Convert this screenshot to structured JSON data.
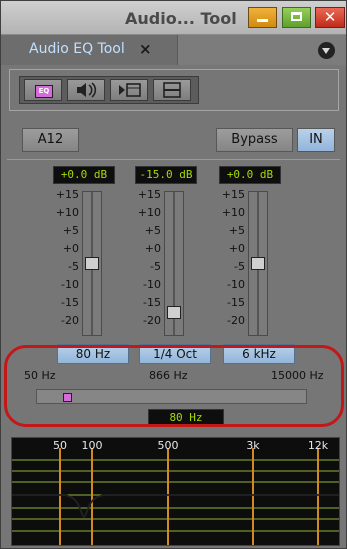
{
  "window": {
    "title": "Audio... Tool"
  },
  "tab": {
    "label": "Audio EQ Tool",
    "close": "×"
  },
  "toolbar": {
    "eq_icon_text": "EQ",
    "icons": [
      "eq-icon",
      "audio-swap-icon",
      "play-frame-icon",
      "split-icon"
    ]
  },
  "controls": {
    "track_button": "A12",
    "bypass_button": "Bypass",
    "in_button": "IN"
  },
  "bands": [
    {
      "readout": "+0.0 dB",
      "freq": "80 Hz",
      "gain_fraction": 0.5
    },
    {
      "readout": "-15.0 dB",
      "freq": "1/4 Oct",
      "gain_fraction": 0.125
    },
    {
      "readout": "+0.0 dB",
      "freq": "6 kHz",
      "gain_fraction": 0.5
    }
  ],
  "scale_labels": [
    "+15",
    "+10",
    "+5",
    "+0",
    "-5",
    "-10",
    "-15",
    "-20"
  ],
  "hpf": {
    "min_label": "50 Hz",
    "mid_label": "866 Hz",
    "max_label": "15000 Hz",
    "readout": "80 Hz",
    "position_fraction": 0.1
  },
  "graph": {
    "freq_labels": [
      "50",
      "100",
      "500",
      "3k",
      "12k"
    ]
  },
  "colors": {
    "accent_blue": "#bfe0ff",
    "readout_green": "#a6d80a",
    "highlight_red": "#c21818",
    "hpf_knob": "#d36cd8",
    "graph_grid": "#93b23a",
    "graph_marker": "#d08a1d"
  }
}
